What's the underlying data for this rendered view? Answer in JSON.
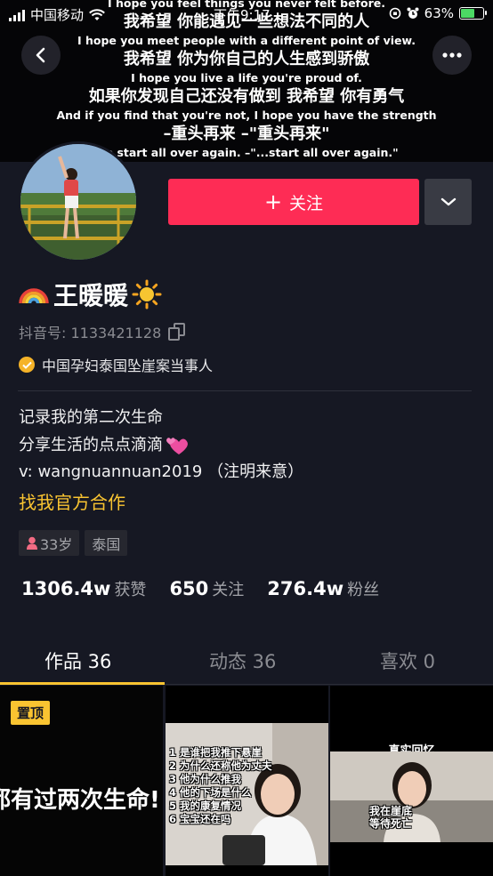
{
  "status_bar": {
    "carrier": "中国移动",
    "time": "下午9:17",
    "battery": "63%"
  },
  "banner": {
    "lines": [
      {
        "lang": "en",
        "text": "I hope you feel things you never felt before."
      },
      {
        "lang": "zh",
        "text": "我希望 你能遇见一些想法不同的人"
      },
      {
        "lang": "en",
        "text": "I hope you meet people with a different point of view."
      },
      {
        "lang": "zh",
        "text": "我希望 你为你自己的人生感到骄傲"
      },
      {
        "lang": "en",
        "text": "I hope you live a life you're proud of."
      },
      {
        "lang": "zh",
        "text": "如果你发现自己还没有做到 我希望 你有勇气"
      },
      {
        "lang": "en",
        "text": "And if you find that you're not, I hope you have the strength"
      },
      {
        "lang": "zh",
        "text": "–重头再来 –\"重头再来\""
      },
      {
        "lang": "en",
        "text": "–to start all over again. –\"...start all over again.\""
      }
    ]
  },
  "profile": {
    "follow_label": "关注",
    "name": "王暖暖",
    "uid_label": "抖音号: 1133421128",
    "verification": "中国孕妇泰国坠崖案当事人",
    "bio": [
      "记录我的第二次生命",
      "分享生活的点点滴滴",
      "v: wangnuannuan2019 （注明来意）"
    ],
    "cooperate_link": "找我官方合作",
    "tags": {
      "age": "33岁",
      "location": "泰国"
    }
  },
  "stats": [
    {
      "value": "1306.4w",
      "label": "获赞"
    },
    {
      "value": "650",
      "label": "关注"
    },
    {
      "value": "276.4w",
      "label": "粉丝"
    }
  ],
  "tabs": [
    {
      "label": "作品 36",
      "active": true
    },
    {
      "label": "动态 36",
      "active": false
    },
    {
      "label": "喜欢 0",
      "active": false
    }
  ],
  "videos": {
    "v1": {
      "badge": "置顶",
      "caption": "都有过两次生命!"
    },
    "v2": {
      "list": [
        "1 是谁把我推下悬崖",
        "2 为什么还称他为丈夫",
        "3 他为什么推我",
        "4 他的下场是什么",
        "5 我的康复情况",
        "6 宝宝还在吗"
      ]
    },
    "v3": {
      "title": "真实回忆",
      "subtitle_1": "我在崖底",
      "subtitle_2": "等待死亡"
    }
  },
  "colors": {
    "background": "#161823",
    "follow": "#fe2c55",
    "accent": "#f9c431",
    "secondary_text": "#8a8b91"
  }
}
